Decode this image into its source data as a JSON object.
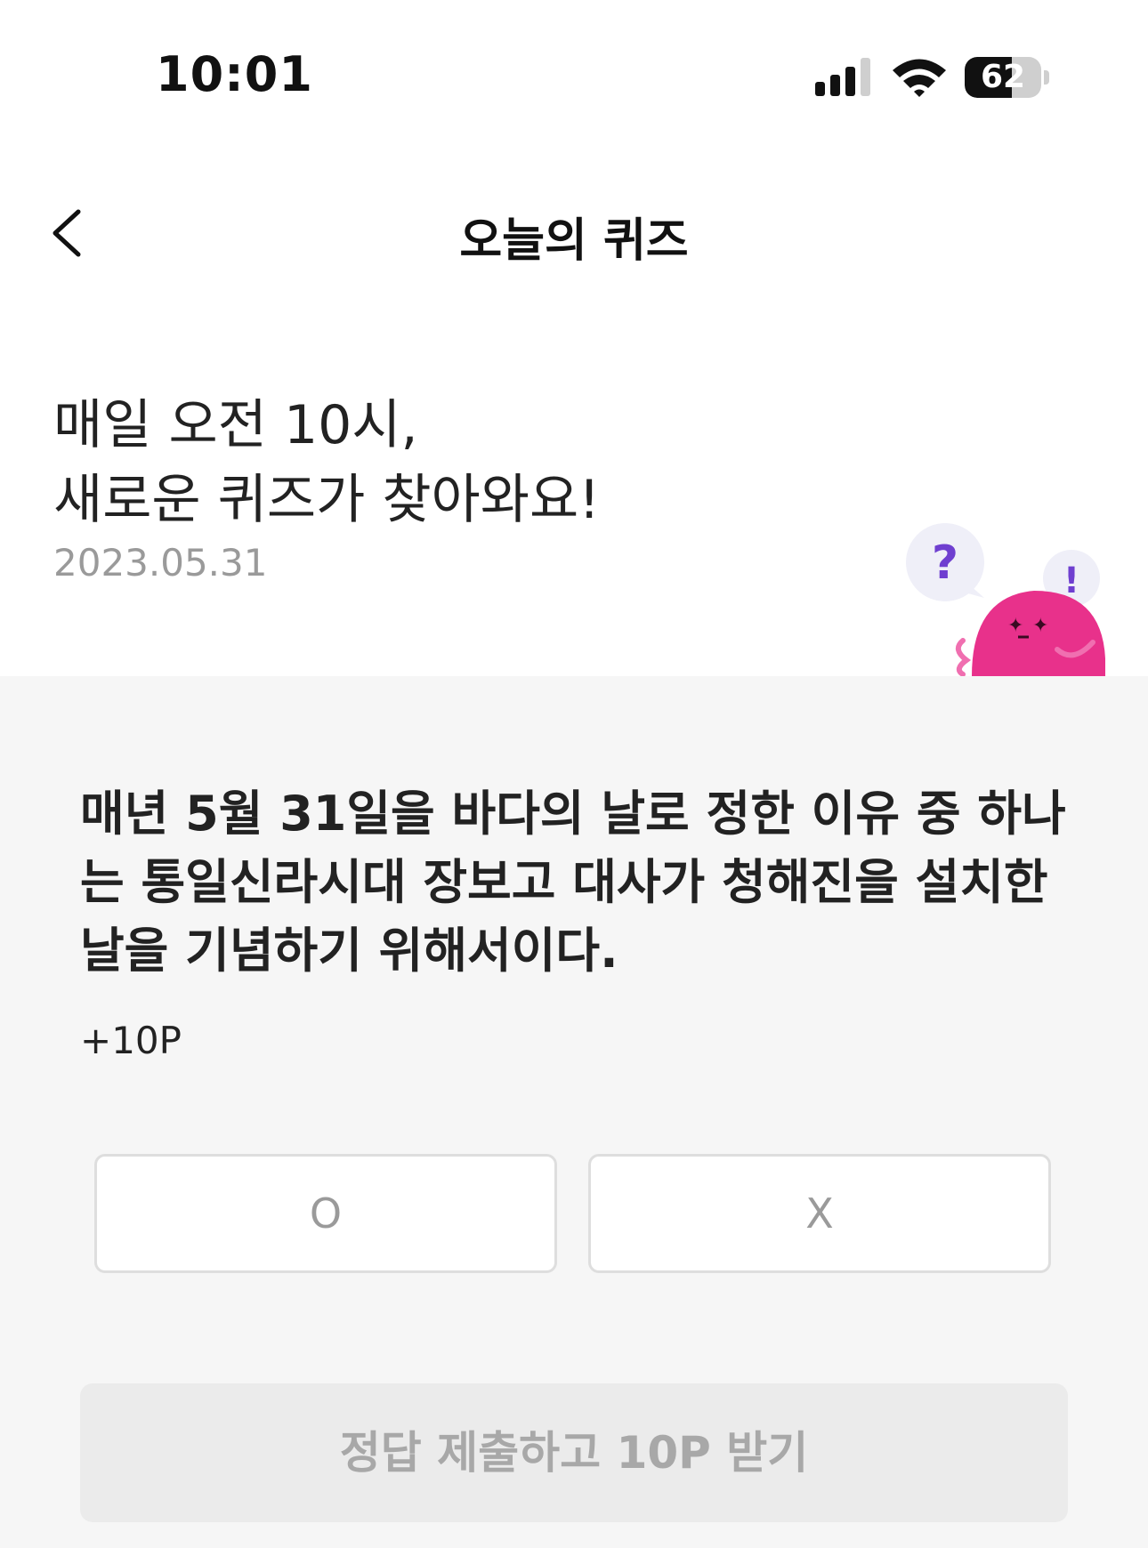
{
  "status_bar": {
    "time": "10:01",
    "battery_level": "62",
    "battery_fraction": 0.62,
    "icons": [
      "signal-icon",
      "wifi-icon",
      "battery-icon"
    ]
  },
  "header": {
    "title": "오늘의 퀴즈",
    "back_icon": "chevron-left-icon"
  },
  "intro": {
    "line1": "매일 오전 10시,",
    "line2": "새로운 퀴즈가 찾아와요!",
    "date": "2023.05.31"
  },
  "mascot": {
    "question_mark": "?",
    "exclamation_mark": "!"
  },
  "quiz": {
    "question": "매년 5월 31일을 바다의 날로 정한 이유 중 하나는 통일신라시대 장보고 대사가 청해진을 설치한 날을 기념하기 위해서이다.",
    "points": "+10P",
    "option_o": "O",
    "option_x": "X",
    "submit_label": "정답 제출하고 10P 받기"
  },
  "colors": {
    "panel_bg": "#f6f6f6",
    "mascot_pink": "#e8318b",
    "question_accent": "#6f3fd0",
    "disabled_text": "#a8a8a8"
  }
}
